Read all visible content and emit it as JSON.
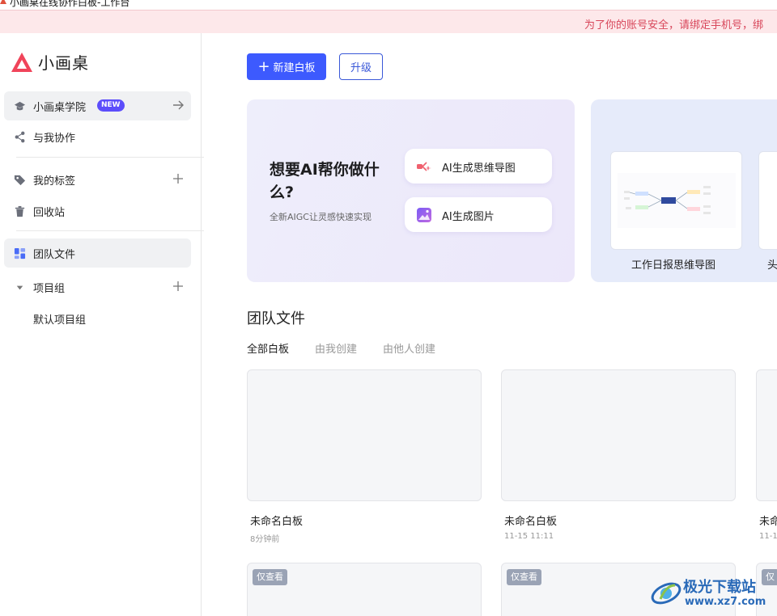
{
  "window": {
    "title": "小画桌在线协作白板-工作台"
  },
  "notice": {
    "text": "为了你的账号安全，请绑定手机号，绑"
  },
  "brand": {
    "name": "小画桌",
    "color": "#f0445a"
  },
  "sidebar": {
    "items": [
      {
        "label": "小画桌学院",
        "badge": "NEW",
        "icon": "graduation-cap-icon",
        "action": "arrow-right-icon"
      },
      {
        "label": "与我协作",
        "icon": "share-icon"
      },
      {
        "label": "我的标签",
        "icon": "tag-icon",
        "action": "plus-icon"
      },
      {
        "label": "回收站",
        "icon": "trash-icon"
      },
      {
        "label": "团队文件",
        "icon": "team-files-icon",
        "active": true
      },
      {
        "label": "项目组",
        "icon": "caret-down-icon",
        "action": "plus-icon"
      },
      {
        "label": "默认项目组"
      }
    ]
  },
  "toolbar": {
    "new_label": "新建白板",
    "upgrade_label": "升级",
    "accent": "#3d5afe"
  },
  "ai_banner": {
    "heading": "想要AI帮你做什么?",
    "subtitle": "全新AIGC让灵感快速实现",
    "actions": [
      {
        "label": "AI生成思维导图",
        "icon": "ai-mindmap-icon"
      },
      {
        "label": "AI生成图片",
        "icon": "ai-image-icon"
      }
    ]
  },
  "templates": [
    {
      "label": "工作日报思维导图"
    },
    {
      "label": "头"
    }
  ],
  "section": {
    "title": "团队文件",
    "tabs": [
      "全部白板",
      "由我创建",
      "由他人创建"
    ]
  },
  "files": [
    {
      "name": "未命名白板",
      "time": "8分钟前"
    },
    {
      "name": "未命名白板",
      "time": "11-15 11:11"
    },
    {
      "name": "未命",
      "time": "11-1"
    }
  ],
  "files_row2": [
    {
      "tag": "仅查看"
    },
    {
      "tag": "仅查看"
    },
    {
      "tag": "仅"
    }
  ],
  "watermark": {
    "title": "极光下载站",
    "url": "www.xz7.com"
  }
}
